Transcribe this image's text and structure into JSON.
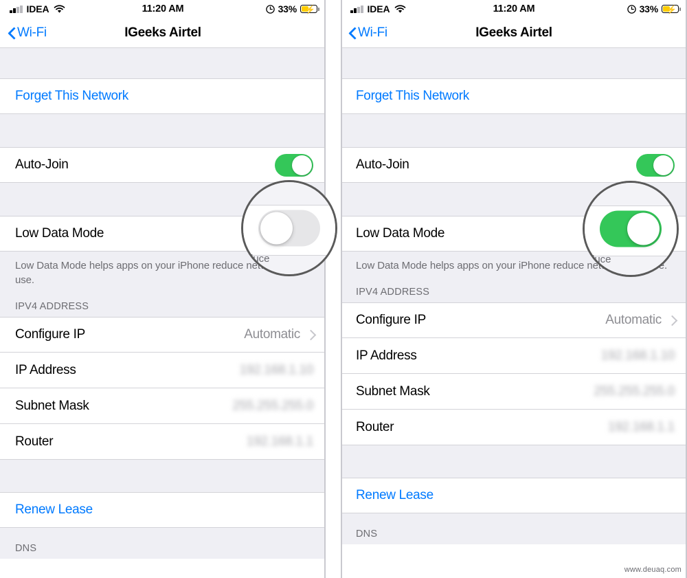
{
  "status_bar": {
    "carrier": "IDEA",
    "time": "11:20 AM",
    "battery_percent": "33%",
    "signal_icon": "signal-bars-icon",
    "wifi_icon": "wifi-icon",
    "alarm_icon": "alarm-clock-icon",
    "battery_icon": "battery-charging-icon"
  },
  "nav": {
    "back_label": "Wi-Fi",
    "title": "IGeeks Airtel",
    "back_icon": "chevron-left-icon"
  },
  "rows": {
    "forget_network": "Forget This Network",
    "auto_join": "Auto-Join",
    "low_data_mode": "Low Data Mode",
    "footnote": "Low Data Mode helps apps on your iPhone reduce network data use.",
    "ipv4_section": "IPV4 ADDRESS",
    "configure_ip": "Configure IP",
    "configure_ip_value": "Automatic",
    "ip_address": "IP Address",
    "ip_address_value": "192.168.1.10",
    "subnet_mask": "Subnet Mask",
    "subnet_mask_value": "255.255.255.0",
    "router": "Router",
    "router_value": "192.168.1.1",
    "renew_lease": "Renew Lease",
    "dns_section": "DNS"
  },
  "toggles": {
    "auto_join_state": "on",
    "low_data_mode_left_state": "off",
    "low_data_mode_right_state": "on"
  },
  "magnifier": {
    "ghost_text": "duce",
    "left_caption": "low-data-mode-toggle-off",
    "right_caption": "low-data-mode-toggle-on"
  },
  "colors": {
    "accent_blue": "#007aff",
    "toggle_green": "#34c759",
    "group_bg": "#efeff4",
    "separator": "#d3d3d8",
    "secondary_text": "#8e8e93",
    "battery_yellow": "#ffcc00"
  },
  "watermark": "www.deuaq.com"
}
